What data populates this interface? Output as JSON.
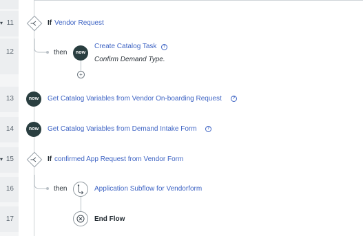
{
  "steps": [
    {
      "num": "11",
      "has_chevron": true
    },
    {
      "num": "12"
    },
    {
      "num": "13"
    },
    {
      "num": "14"
    },
    {
      "num": "15",
      "has_chevron": true
    },
    {
      "num": "16"
    },
    {
      "num": "17"
    }
  ],
  "step11": {
    "keyword": "If",
    "condition": "Vendor Request"
  },
  "step12": {
    "then": "then",
    "badge": "now",
    "action": "Create Catalog Task",
    "annotation": "Confirm Demand Type.",
    "add_symbol": "+"
  },
  "step13": {
    "badge": "now",
    "action": "Get Catalog Variables from Vendor On-boarding Request"
  },
  "step14": {
    "badge": "now",
    "action": "Get Catalog Variables from Demand Intake Form"
  },
  "step15": {
    "keyword": "If",
    "condition": "confirmed App Request from Vendor Form"
  },
  "step16": {
    "then": "then",
    "action": "Application Subflow for Vendorform"
  },
  "step17": {
    "label": "End Flow"
  },
  "icons": {
    "chevron": "chevron-down-icon",
    "condition": "branch-condition-icon",
    "help": "help-icon",
    "subflow": "subflow-icon",
    "end": "end-flow-icon"
  },
  "colors": {
    "link": "#3e64c4",
    "now_badge": "#293e40",
    "gutter": "#eceef0"
  },
  "help_symbol": "?",
  "chevron_symbol": "▾"
}
